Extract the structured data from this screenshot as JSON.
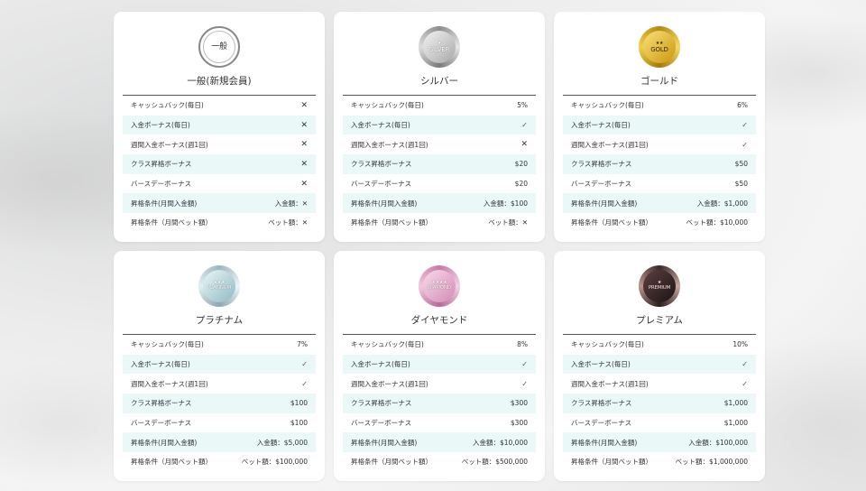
{
  "cards": [
    {
      "badge_text": "一般",
      "title": "一般(新規会員)",
      "rows": [
        {
          "label": "キャッシュバック(毎日)",
          "value": "✕"
        },
        {
          "label": "入金ボーナス(毎日)",
          "value": "✕"
        },
        {
          "label": "週間入金ボーナス(週1回)",
          "value": "✕"
        },
        {
          "label": "クラス昇格ボーナス",
          "value": "✕"
        },
        {
          "label": "バースデーボーナス",
          "value": "✕"
        },
        {
          "label": "昇格条件(月間入金額)",
          "value": "入金額：✕"
        },
        {
          "label": "昇格条件（月間ベット額）",
          "value": "ベット額：✕"
        }
      ]
    },
    {
      "badge_text": "SILVER",
      "title": "シルバー",
      "rows": [
        {
          "label": "キャッシュバック(毎日)",
          "value": "5%"
        },
        {
          "label": "入金ボーナス(毎日)",
          "value": "✓"
        },
        {
          "label": "週間入金ボーナス(週1回)",
          "value": "✕"
        },
        {
          "label": "クラス昇格ボーナス",
          "value": "$20"
        },
        {
          "label": "バースデーボーナス",
          "value": "$20"
        },
        {
          "label": "昇格条件(月間入金額)",
          "value": "入金額：$100"
        },
        {
          "label": "昇格条件（月間ベット額）",
          "value": "ベット額：✕"
        }
      ]
    },
    {
      "badge_text": "GOLD",
      "title": "ゴールド",
      "rows": [
        {
          "label": "キャッシュバック(毎日)",
          "value": "6%"
        },
        {
          "label": "入金ボーナス(毎日)",
          "value": "✓"
        },
        {
          "label": "週間入金ボーナス(週1回)",
          "value": "✓"
        },
        {
          "label": "クラス昇格ボーナス",
          "value": "$50"
        },
        {
          "label": "バースデーボーナス",
          "value": "$50"
        },
        {
          "label": "昇格条件(月間入金額)",
          "value": "入金額：$1,000"
        },
        {
          "label": "昇格条件（月間ベット額）",
          "value": "ベット額：$10,000"
        }
      ]
    },
    {
      "badge_text": "PLATINUM",
      "title": "プラチナム",
      "rows": [
        {
          "label": "キャッシュバック(毎日)",
          "value": "7%"
        },
        {
          "label": "入金ボーナス(毎日)",
          "value": "✓"
        },
        {
          "label": "週間入金ボーナス(週1回)",
          "value": "✓"
        },
        {
          "label": "クラス昇格ボーナス",
          "value": "$100"
        },
        {
          "label": "バースデーボーナス",
          "value": "$100"
        },
        {
          "label": "昇格条件(月間入金額)",
          "value": "入金額：$5,000"
        },
        {
          "label": "昇格条件（月間ベット額）",
          "value": "ベット額：$100,000"
        }
      ]
    },
    {
      "badge_text": "DIAMOND",
      "title": "ダイヤモンド",
      "rows": [
        {
          "label": "キャッシュバック(毎日)",
          "value": "8%"
        },
        {
          "label": "入金ボーナス(毎日)",
          "value": "✓"
        },
        {
          "label": "週間入金ボーナス(週1回)",
          "value": "✓"
        },
        {
          "label": "クラス昇格ボーナス",
          "value": "$300"
        },
        {
          "label": "バースデーボーナス",
          "value": "$300"
        },
        {
          "label": "昇格条件(月間入金額)",
          "value": "入金額：$10,000"
        },
        {
          "label": "昇格条件（月間ベット額）",
          "value": "ベット額：$500,000"
        }
      ]
    },
    {
      "badge_text": "PREMIUM",
      "title": "プレミアム",
      "rows": [
        {
          "label": "キャッシュバック(毎日)",
          "value": "10%"
        },
        {
          "label": "入金ボーナス(毎日)",
          "value": "✓"
        },
        {
          "label": "週間入金ボーナス(週1回)",
          "value": "✓"
        },
        {
          "label": "クラス昇格ボーナス",
          "value": "$1,000"
        },
        {
          "label": "バースデーボーナス",
          "value": "$1,000"
        },
        {
          "label": "昇格条件(月間入金額)",
          "value": "入金額：$100,000"
        },
        {
          "label": "昇格条件（月間ベット額）",
          "value": "ベット額：$1,000,000"
        }
      ]
    }
  ]
}
